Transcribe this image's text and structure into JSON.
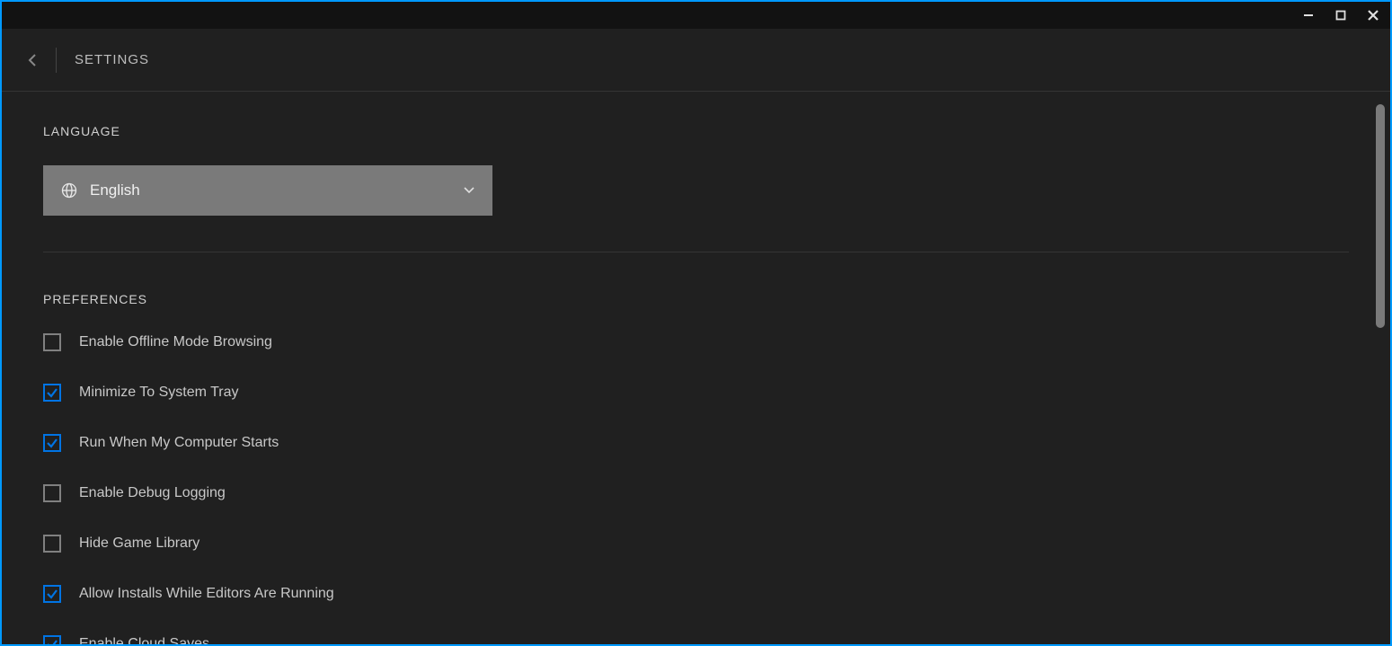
{
  "window": {
    "minimize": "minimize",
    "maximize": "maximize",
    "close": "close"
  },
  "header": {
    "title": "SETTINGS"
  },
  "language": {
    "section_title": "LANGUAGE",
    "selected": "English"
  },
  "preferences": {
    "section_title": "PREFERENCES",
    "items": [
      {
        "label": "Enable Offline Mode Browsing",
        "checked": false
      },
      {
        "label": "Minimize To System Tray",
        "checked": true
      },
      {
        "label": "Run When My Computer Starts",
        "checked": true
      },
      {
        "label": "Enable Debug Logging",
        "checked": false
      },
      {
        "label": "Hide Game Library",
        "checked": false
      },
      {
        "label": "Allow Installs While Editors Are Running",
        "checked": true
      },
      {
        "label": "Enable Cloud Saves",
        "checked": true
      }
    ]
  }
}
